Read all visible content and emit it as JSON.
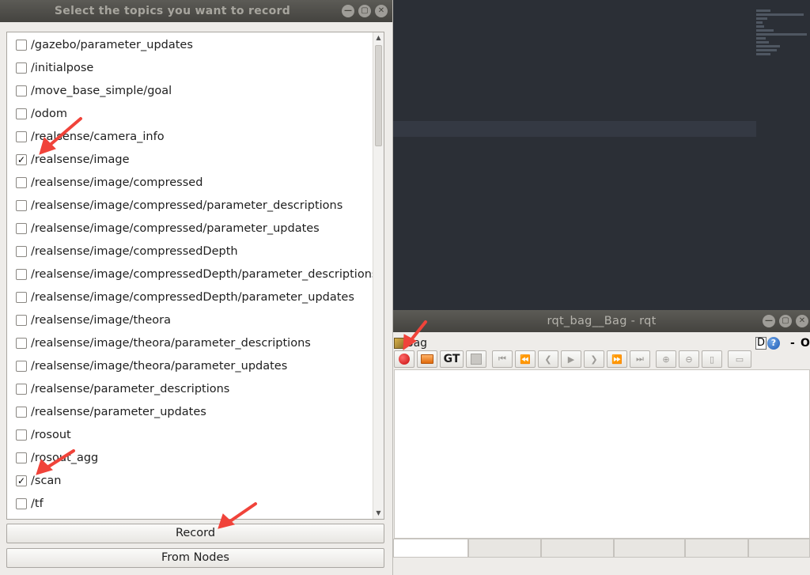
{
  "dialog": {
    "title": "Select the topics you want to record",
    "window_buttons": [
      "✕",
      "▢",
      "—"
    ],
    "topics": [
      {
        "label": "/gazebo/parameter_updates",
        "checked": false
      },
      {
        "label": "/initialpose",
        "checked": false
      },
      {
        "label": "/move_base_simple/goal",
        "checked": false
      },
      {
        "label": "/odom",
        "checked": false
      },
      {
        "label": "/realsense/camera_info",
        "checked": false
      },
      {
        "label": "/realsense/image",
        "checked": true
      },
      {
        "label": "/realsense/image/compressed",
        "checked": false
      },
      {
        "label": "/realsense/image/compressed/parameter_descriptions",
        "checked": false
      },
      {
        "label": "/realsense/image/compressed/parameter_updates",
        "checked": false
      },
      {
        "label": "/realsense/image/compressedDepth",
        "checked": false
      },
      {
        "label": "/realsense/image/compressedDepth/parameter_descriptions",
        "checked": false
      },
      {
        "label": "/realsense/image/compressedDepth/parameter_updates",
        "checked": false
      },
      {
        "label": "/realsense/image/theora",
        "checked": false
      },
      {
        "label": "/realsense/image/theora/parameter_descriptions",
        "checked": false
      },
      {
        "label": "/realsense/image/theora/parameter_updates",
        "checked": false
      },
      {
        "label": "/realsense/parameter_descriptions",
        "checked": false
      },
      {
        "label": "/realsense/parameter_updates",
        "checked": false
      },
      {
        "label": "/rosout",
        "checked": false
      },
      {
        "label": "/rosout_agg",
        "checked": false
      },
      {
        "label": "/scan",
        "checked": true
      },
      {
        "label": "/tf",
        "checked": false
      }
    ],
    "record_label": "Record",
    "from_nodes_label": "From Nodes"
  },
  "rqt": {
    "title": "rqt_bag__Bag - rqt",
    "plugin_title": "Bag",
    "help_d": "D",
    "help_q": "?",
    "dash": "-",
    "o": "O",
    "gt_label": "GT"
  },
  "colors": {
    "arrow": "#f0433a",
    "record_dot": "#d81b1b"
  }
}
